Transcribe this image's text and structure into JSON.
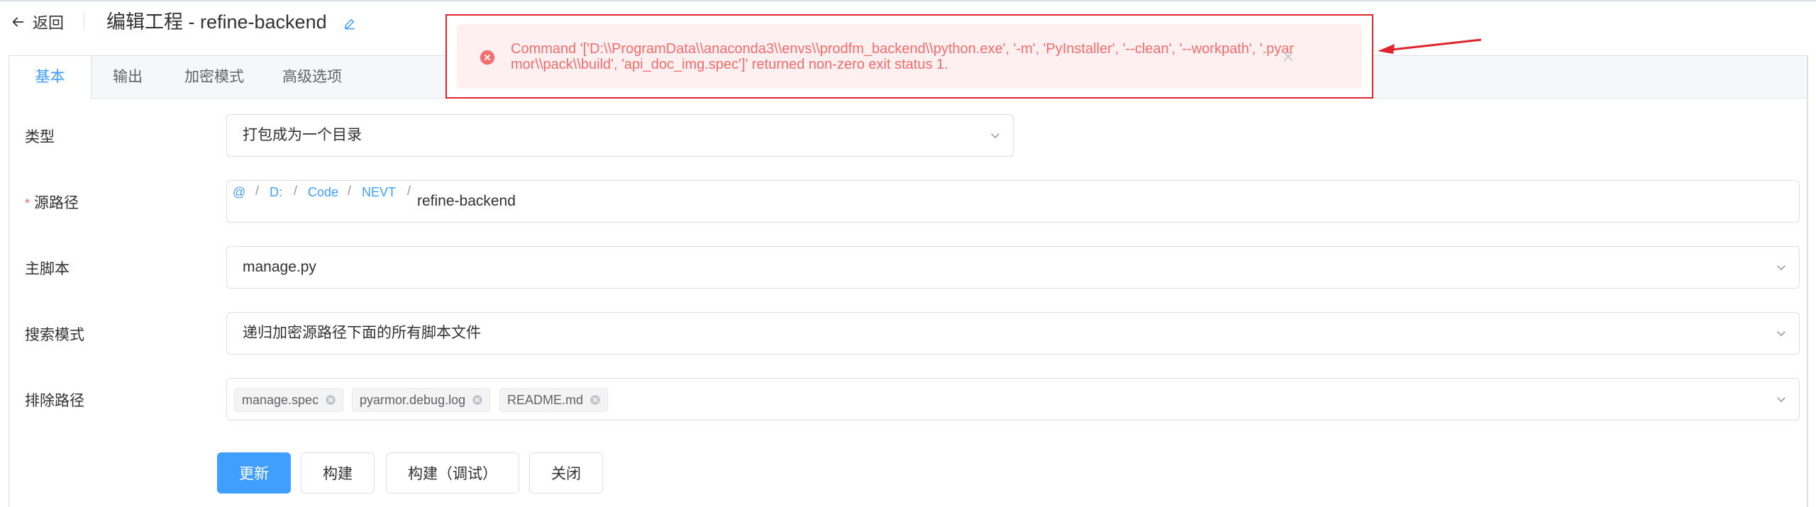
{
  "header": {
    "back_label": "返回",
    "title": "编辑工程 - refine-backend"
  },
  "tabs": [
    {
      "label": "基本",
      "active": true
    },
    {
      "label": "输出",
      "active": false
    },
    {
      "label": "加密模式",
      "active": false
    },
    {
      "label": "高级选项",
      "active": false
    }
  ],
  "form": {
    "type": {
      "label": "类型",
      "value": "打包成为一个目录"
    },
    "source_path": {
      "label": "源路径",
      "required": true,
      "crumbs": [
        "@",
        "D:",
        "Code",
        "NEVT"
      ],
      "separator": "/",
      "current": "refine-backend"
    },
    "main_script": {
      "label": "主脚本",
      "value": "manage.py"
    },
    "search_mode": {
      "label": "搜索模式",
      "value": "递归加密源路径下面的所有脚本文件"
    },
    "exclude_paths": {
      "label": "排除路径",
      "tags": [
        "manage.spec",
        "pyarmor.debug.log",
        "README.md"
      ]
    }
  },
  "buttons": {
    "update": "更新",
    "build": "构建",
    "build_debug": "构建（调试）",
    "close": "关闭"
  },
  "alert": {
    "message": "Command '['D:\\\\ProgramData\\\\anaconda3\\\\envs\\\\prodfm_backend\\\\python.exe', '-m', 'PyInstaller', '--clean', '--workpath', '.pyarmor\\\\pack\\\\build', 'api_doc_img.spec']' returned non-zero exit status 1."
  },
  "colors": {
    "primary": "#409eff",
    "danger": "#f56c6c",
    "annotation_red": "#e0242c"
  }
}
